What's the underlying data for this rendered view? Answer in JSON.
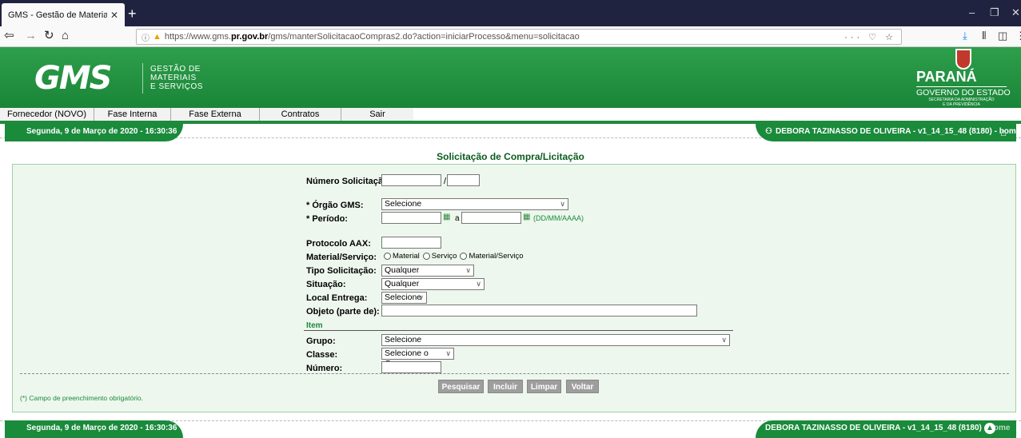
{
  "browser": {
    "tab_title": "GMS - Gestão de Materiais e Serviço",
    "url_prefix": "https://www.gms.",
    "url_domain": "pr.gov.br",
    "url_path": "/gms/manterSolicitacaoCompras2.do?action=iniciarProcesso&menu=solicitacao"
  },
  "header": {
    "logo": "GMS",
    "subtitle_1": "GESTÃO DE",
    "subtitle_2": "MATERIAIS",
    "subtitle_3": "E SERVIÇOS",
    "state": "PARANÁ",
    "government": "GOVERNO DO ESTADO",
    "secretariat_1": "SECRETARIA DA ADMINISTRAÇÃO",
    "secretariat_2": "E DA PREVIDÊNCIA"
  },
  "menu": [
    "Fornecedor (NOVO)",
    "Fase Interna",
    "Fase Externa",
    "Contratos",
    "Sair"
  ],
  "status": {
    "datetime": "Segunda, 9 de Março de 2020 - 16:30:36",
    "user": "DEBORA TAZINASSO DE OLIVEIRA - v1_14_15_48 (8180)",
    "home_sep": " - ",
    "home": "home"
  },
  "page_title": "Solicitação de Compra/Licitação",
  "form": {
    "numero_label": "Número Solicitação:",
    "orgao_label": "* Órgão GMS:",
    "orgao_value": "Selecione",
    "periodo_label": "* Período:",
    "periodo_sep": "a",
    "periodo_format": "(DD/MM/AAAA)",
    "protocolo_label": "Protocolo AAX:",
    "material_label": "Material/Serviço:",
    "radio_material": "Material",
    "radio_servico": "Serviço",
    "radio_ambos": "Material/Serviço",
    "tipo_label": "Tipo Solicitação:",
    "tipo_value": "Qualquer",
    "situacao_label": "Situação:",
    "situacao_value": "Qualquer",
    "local_label": "Local Entrega:",
    "local_value": "Selecione",
    "objeto_label": "Objeto (parte de):",
    "item_section": "Item",
    "grupo_label": "Grupo:",
    "grupo_value": "Selecione",
    "classe_label": "Classe:",
    "classe_value": "Selecione o Grupo",
    "numero_item_label": "Número:",
    "required_note": "(*) Campo de preenchimento obrigatório."
  },
  "buttons": {
    "pesquisar": "Pesquisar",
    "incluir": "Incluir",
    "limpar": "Limpar",
    "voltar": "Voltar"
  },
  "colors": {
    "brand_green": "#1a8a3b",
    "title_green": "#0a5c1c",
    "panel_bg": "#eef7ee"
  }
}
